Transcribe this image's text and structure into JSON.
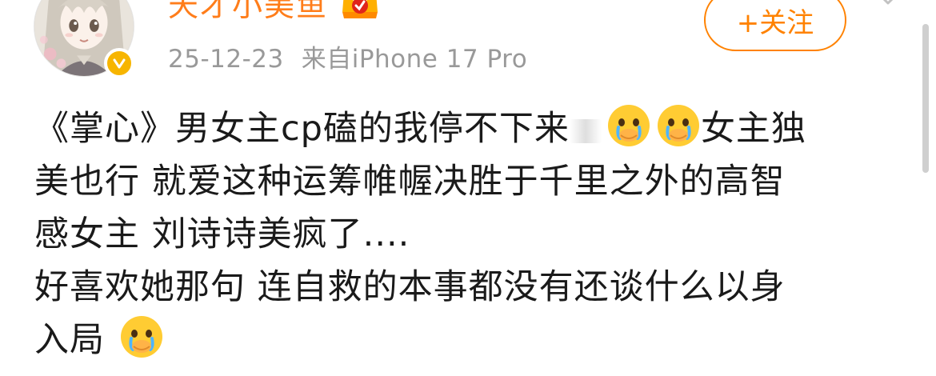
{
  "header": {
    "username": "天才小美鱼",
    "timestamp": "25-12-23",
    "source": "来自iPhone 17 Pro",
    "follow_label": "+关注"
  },
  "post": {
    "line1_text": "《掌心》男女主cp磕的我停不下来",
    "line1_tail": "女主独",
    "line2": "美也行 就爱这种运筹帷幄决胜于千里之外的高智",
    "line3": "感女主 刘诗诗美疯了....",
    "line4": "好喜欢她那句 连自救的本事都没有还谈什么以身",
    "line5": "入局"
  },
  "icons": {
    "avatar": "anime-girl-avatar",
    "verified": "verified-badge-icon",
    "vip": "vip-crown-icon",
    "emoji": "crying-face-emoji",
    "more": "chevron-down-icon"
  },
  "colors": {
    "username": "#ff7d1a",
    "follow_accent": "#ff8200",
    "meta_text": "#999999",
    "badge": "#f7b500"
  }
}
